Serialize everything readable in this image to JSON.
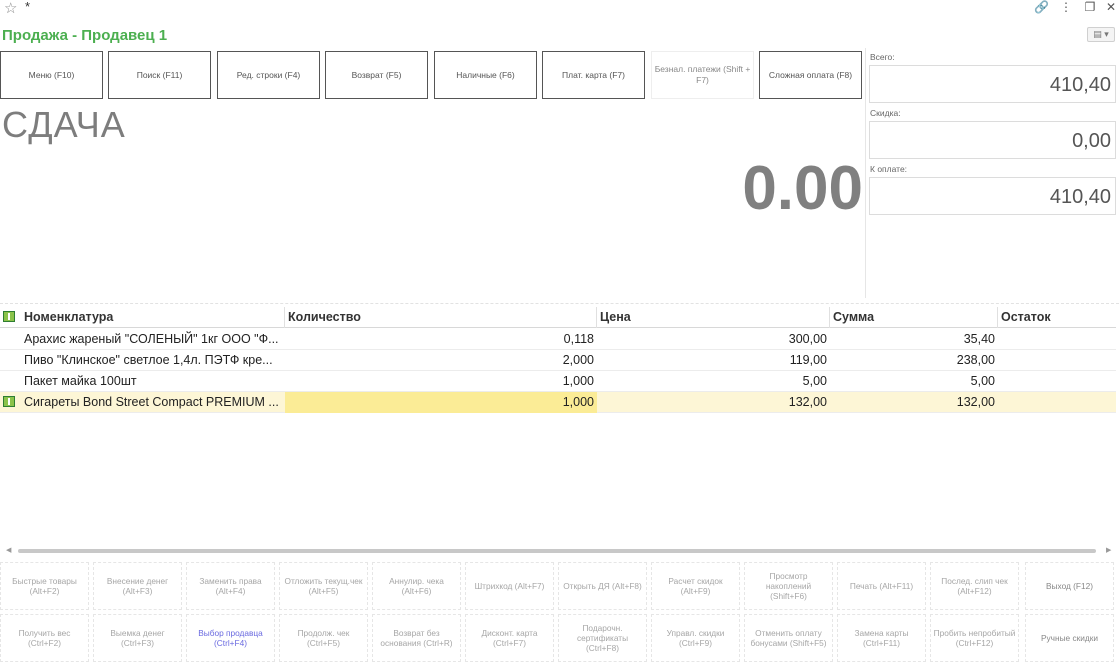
{
  "window": {
    "star_icon": "star-icon",
    "modified_marker": "*",
    "title": "Продажа - Продавец 1"
  },
  "function_buttons": [
    {
      "label": "Меню (F10)",
      "enabled": true
    },
    {
      "label": "Поиск (F11)",
      "enabled": true
    },
    {
      "label": "Ред. строки (F4)",
      "enabled": true
    },
    {
      "label": "Возврат (F5)",
      "enabled": true
    },
    {
      "label": "Наличные (F6)",
      "enabled": true
    },
    {
      "label": "Плат. карта (F7)",
      "enabled": true
    },
    {
      "label": "Безнал. платежи (Shift + F7)",
      "enabled": false
    },
    {
      "label": "Сложная оплата (F8)",
      "enabled": true
    }
  ],
  "change": {
    "label": "СДАЧА",
    "value": "0.00"
  },
  "totals": {
    "total_label": "Всего:",
    "total_value": "410,40",
    "discount_label": "Скидка:",
    "discount_value": "0,00",
    "to_pay_label": "К оплате:",
    "to_pay_value": "410,40"
  },
  "table": {
    "headers": [
      "Номенклатура",
      "Количество",
      "Цена",
      "Сумма",
      "Остаток"
    ],
    "rows": [
      {
        "name": "Арахис жареный \"СОЛЕНЫЙ\" 1кг ООО \"Ф...",
        "qty": "0,118",
        "price": "300,00",
        "sum": "35,40",
        "rest": ""
      },
      {
        "name": "Пиво \"Клинское\" светлое 1,4л. ПЭТФ кре...",
        "qty": "2,000",
        "price": "119,00",
        "sum": "238,00",
        "rest": ""
      },
      {
        "name": "Пакет майка  100шт",
        "qty": "1,000",
        "price": "5,00",
        "sum": "5,00",
        "rest": ""
      },
      {
        "name": "Сигареты Bond Street Compact PREMIUM ...",
        "qty": "1,000",
        "price": "132,00",
        "sum": "132,00",
        "rest": ""
      }
    ]
  },
  "bottom_buttons": {
    "row1": [
      "Быстрые товары (Alt+F2)",
      "Внесение денег (Alt+F3)",
      "Заменить права (Alt+F4)",
      "Отложить текущ.чек (Alt+F5)",
      "Аннулир. чека (Alt+F6)",
      "Штрихкод (Alt+F7)",
      "Открыть ДЯ (Alt+F8)",
      "Расчет скидок (Alt+F9)",
      "Просмотр накоплений (Shift+F6)",
      "Печать (Alt+F11)",
      "Послед. слип чек (Alt+F12)",
      "Выход (F12)"
    ],
    "row2": [
      "Получить вес (Ctrl+F2)",
      "Выемка денег (Ctrl+F3)",
      "Выбор продавца (Ctrl+F4)",
      "Продолж. чек (Ctrl+F5)",
      "Возврат без основания (Ctrl+R)",
      "Дисконт. карта (Ctrl+F7)",
      "Подарочн. сертификаты (Ctrl+F8)",
      "Управл. скидки (Ctrl+F9)",
      "Отменить оплату бонусами (Shift+F5)",
      "Замена карты (Ctrl+F11)",
      "Пробить непробитый (Ctrl+F12)",
      "Ручные скидки"
    ]
  }
}
